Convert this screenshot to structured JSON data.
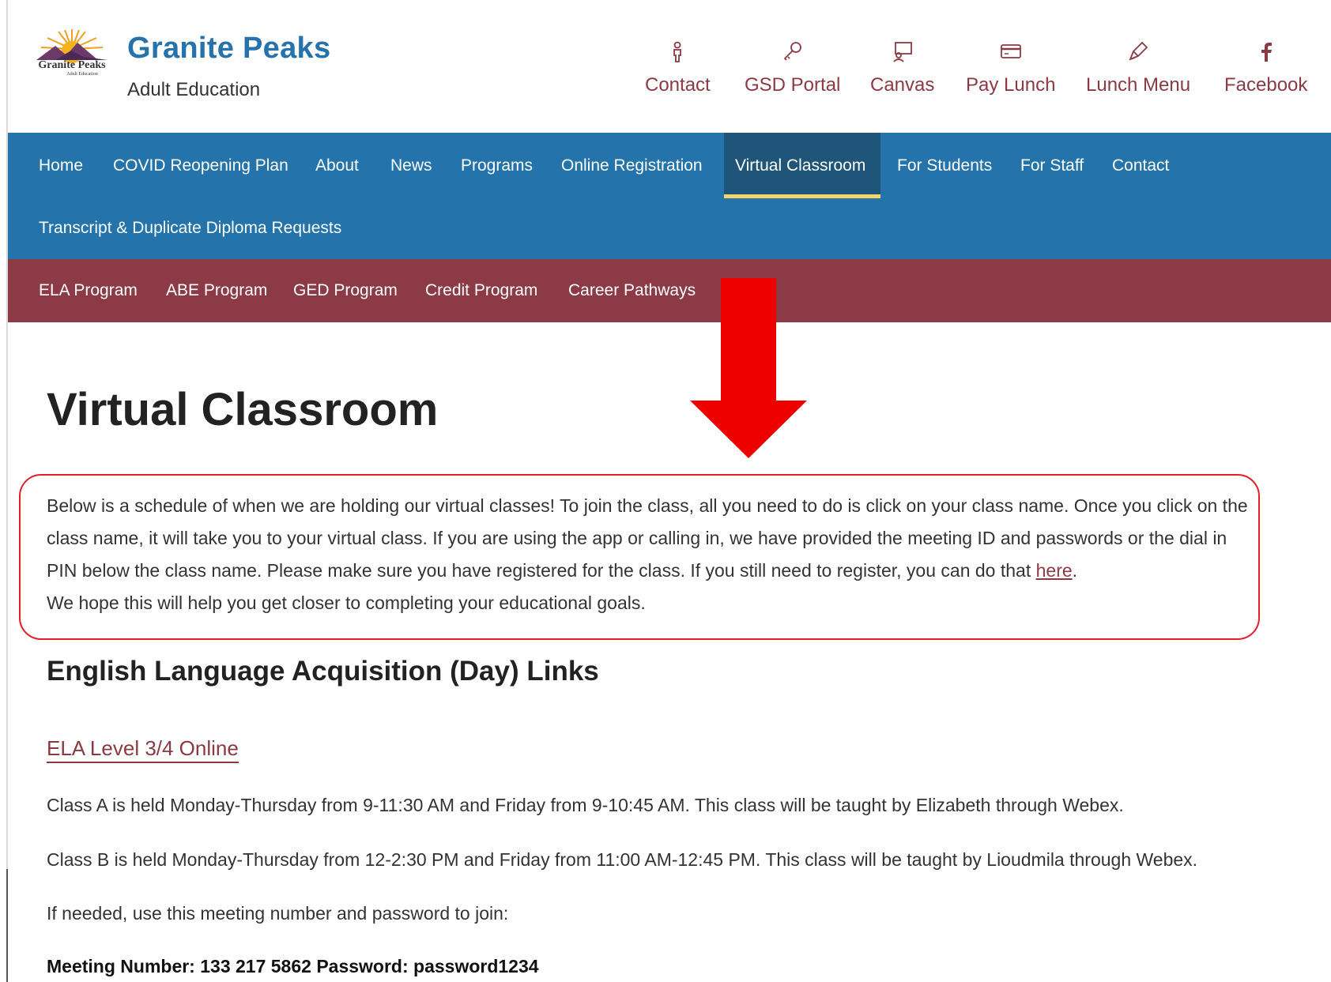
{
  "brand": {
    "logo_text": "Granite Peaks",
    "logo_subtext": "Adult Education",
    "title": "Granite Peaks",
    "subtitle": "Adult Education"
  },
  "utility_links": [
    {
      "label": "Contact",
      "icon": "person-icon"
    },
    {
      "label": "GSD Portal",
      "icon": "key-icon"
    },
    {
      "label": "Canvas",
      "icon": "presentation-icon"
    },
    {
      "label": "Pay Lunch",
      "icon": "credit-card-icon"
    },
    {
      "label": "Lunch Menu",
      "icon": "pen-icon"
    },
    {
      "label": "Facebook",
      "icon": "facebook-icon"
    }
  ],
  "main_nav": [
    "Home",
    "COVID Reopening Plan",
    "About",
    "News",
    "Programs",
    "Online Registration",
    "Virtual Classroom",
    "For Students",
    "For Staff",
    "Contact",
    "Transcript & Duplicate Diploma Requests"
  ],
  "main_nav_active": "Virtual Classroom",
  "sub_nav": [
    "ELA Program",
    "ABE Program",
    "GED Program",
    "Credit Program",
    "Career Pathways"
  ],
  "content": {
    "title": "Virtual Classroom",
    "intro_text": "Below is a schedule of when we are holding our virtual classes! To join the class, all you need to do is click on your class name. Once you click on the class name, it will take you to your virtual class. If you are using the app or calling in, we have provided the meeting ID and passwords or the dial in PIN below the class name. Please make sure you have registered for the class. If you still need to register, you can do that",
    "intro_link": "here",
    "intro_after_link": ".",
    "intro_end": "We hope this will help you get closer to completing your educational goals.",
    "section_heading": "English Language Acquisition (Day) Links",
    "class_link": "ELA Level 3/4 Online",
    "class_a": "Class A is held Monday-Thursday from 9-11:30 AM and Friday from 9-10:45 AM. This class will be taught by Elizabeth through Webex.",
    "class_b": "Class B is held Monday-Thursday from 12-2:30 PM and Friday from 11:00 AM-12:45 PM. This class will be taught by Lioudmila through Webex.",
    "if_needed": "If needed, use this meeting number and password to join:",
    "meeting_info": "Meeting Number: 133 217 5862 Password: password1234"
  },
  "colors": {
    "brand_blue": "#2572ac",
    "nav_blue": "#2474ab",
    "nav_active": "#1f5579",
    "nav_underline": "#f3d56b",
    "sub_nav": "#8c3a45",
    "link": "#8b3a44",
    "annotation_red": "#e41e26"
  }
}
